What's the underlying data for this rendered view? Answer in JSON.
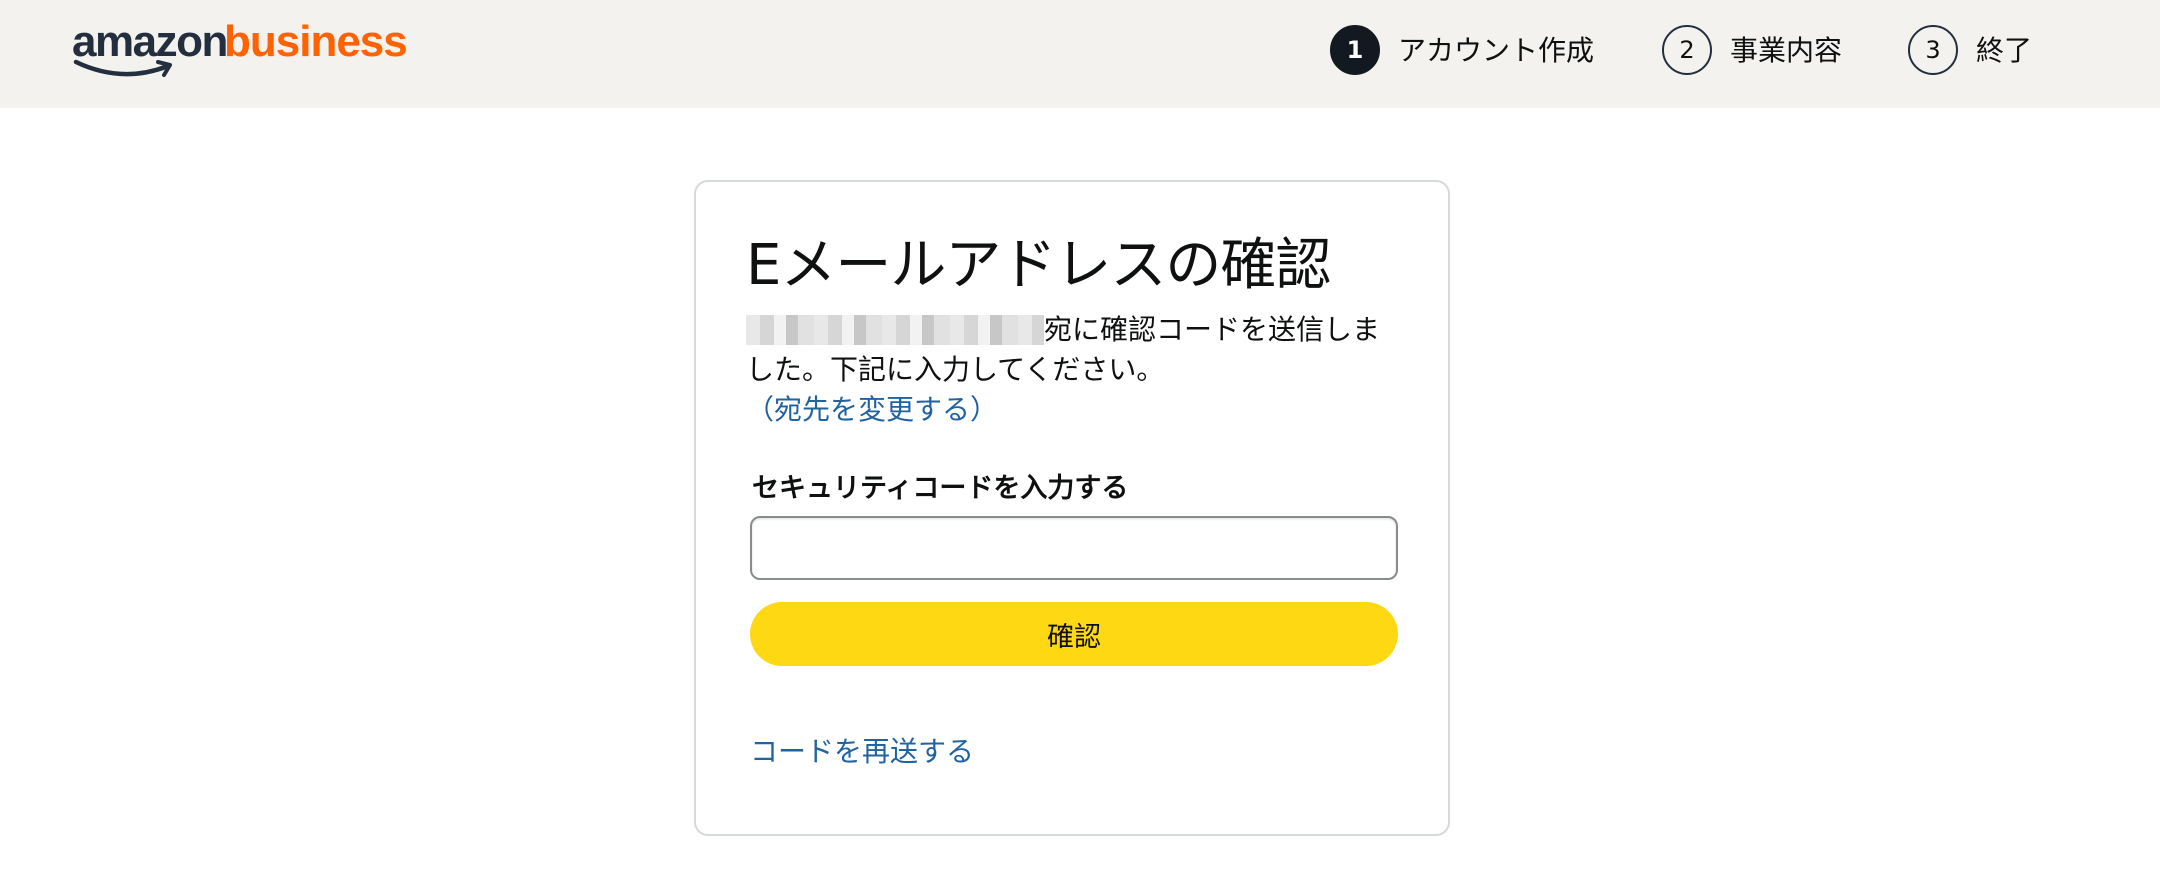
{
  "header": {
    "logo": {
      "amazon": "amazon",
      "business": "business"
    },
    "steps": [
      {
        "number": "1",
        "label": "アカウント作成",
        "active": true
      },
      {
        "number": "2",
        "label": "事業内容",
        "active": false
      },
      {
        "number": "3",
        "label": "終了",
        "active": false
      }
    ]
  },
  "card": {
    "title": "Eメールアドレスの確認",
    "description_text": "宛に確認コードを送信しました。下記に入力してください。",
    "change_recipient_link": "（宛先を変更する）",
    "field_label": "セキュリティコードを入力する",
    "code_input_value": "",
    "confirm_button": "確認",
    "resend_link": "コードを再送する"
  },
  "colors": {
    "header_bg": "#f3f2ef",
    "brand_orange": "#ff6200",
    "brand_dark": "#232f3e",
    "button_yellow": "#ffd814",
    "link_blue": "#2162a1"
  }
}
